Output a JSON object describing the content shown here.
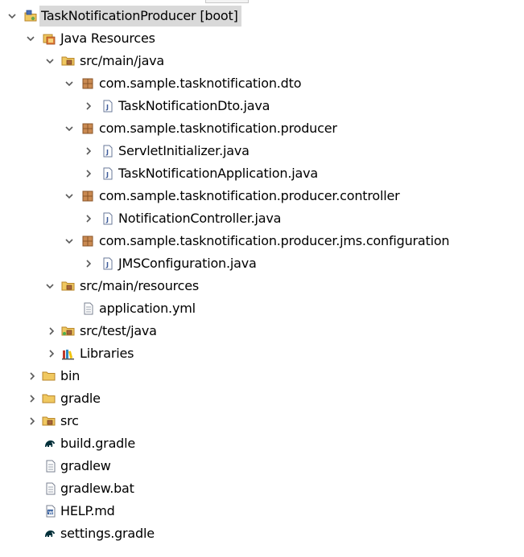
{
  "tree": {
    "project": {
      "label": "TaskNotificationProducer [boot]",
      "icon": "project-icon"
    },
    "java_resources": {
      "label": "Java Resources",
      "icon": "java-resources-icon"
    },
    "src_main_java": {
      "label": "src/main/java",
      "icon": "source-folder-icon"
    },
    "pkg_dto": {
      "label": "com.sample.tasknotification.dto",
      "icon": "package-icon"
    },
    "file_dto": {
      "label": "TaskNotificationDto.java",
      "icon": "java-file-icon"
    },
    "pkg_producer": {
      "label": "com.sample.tasknotification.producer",
      "icon": "package-icon"
    },
    "file_servlet": {
      "label": "ServletInitializer.java",
      "icon": "java-file-icon"
    },
    "file_app": {
      "label": "TaskNotificationApplication.java",
      "icon": "java-file-icon"
    },
    "pkg_controller": {
      "label": "com.sample.tasknotification.producer.controller",
      "icon": "package-icon"
    },
    "file_controller": {
      "label": "NotificationController.java",
      "icon": "java-file-icon"
    },
    "pkg_jms": {
      "label": "com.sample.tasknotification.producer.jms.configuration",
      "icon": "package-icon"
    },
    "file_jms": {
      "label": "JMSConfiguration.java",
      "icon": "java-file-icon"
    },
    "src_main_resources": {
      "label": "src/main/resources",
      "icon": "source-folder-icon"
    },
    "file_yml": {
      "label": "application.yml",
      "icon": "text-file-icon"
    },
    "src_test_java": {
      "label": "src/test/java",
      "icon": "test-source-folder-icon"
    },
    "libraries": {
      "label": "Libraries",
      "icon": "libraries-icon"
    },
    "bin": {
      "label": "bin",
      "icon": "folder-icon"
    },
    "gradle": {
      "label": "gradle",
      "icon": "folder-icon"
    },
    "src": {
      "label": "src",
      "icon": "source-folder-icon"
    },
    "build_gradle": {
      "label": "build.gradle",
      "icon": "gradle-elephant-icon"
    },
    "gradlew": {
      "label": "gradlew",
      "icon": "text-file-icon"
    },
    "gradlew_bat": {
      "label": "gradlew.bat",
      "icon": "text-file-icon"
    },
    "help_md": {
      "label": "HELP.md",
      "icon": "word-file-icon"
    },
    "settings_gradle": {
      "label": "settings.gradle",
      "icon": "gradle-elephant-icon"
    }
  },
  "colors": {
    "selection": "#d9d9d9",
    "twisty": "#5a5a5a",
    "folder": "#e8b84a",
    "package": "#a8653a",
    "java_file": "#3c5a9a",
    "gradle": "#02303a"
  }
}
